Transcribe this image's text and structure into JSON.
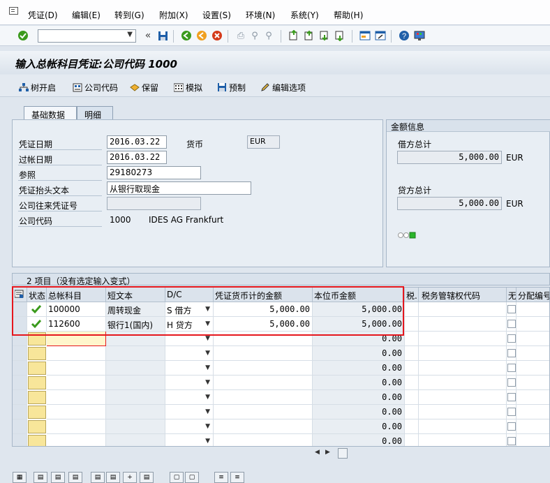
{
  "menubar": {
    "items": [
      "凭证(D)",
      "编辑(E)",
      "转到(G)",
      "附加(X)",
      "设置(S)",
      "环境(N)",
      "系统(Y)",
      "帮助(H)"
    ]
  },
  "toolbar": {
    "command_field_value": "",
    "icons": [
      "enter-icon",
      "back-double-arrow-icon",
      "save-icon",
      "back-icon",
      "exit-icon",
      "cancel-icon",
      "print-icon",
      "find-icon",
      "find-next-icon",
      "first-page-icon",
      "previous-page-icon",
      "next-page-icon",
      "last-page-icon",
      "create-session-icon",
      "shortcut-icon",
      "help-icon",
      "customize-layout-icon"
    ]
  },
  "title": "输入总帐科目凭证:公司代码 1000",
  "app_toolbar": {
    "tree_on": "树开启",
    "company_code": "公司代码",
    "hold": "保留",
    "simulate": "模拟",
    "park": "预制",
    "edit_options": "编辑选项"
  },
  "tabs": [
    "基础数据",
    "明细"
  ],
  "basic": {
    "doc_date_label": "凭证日期",
    "doc_date": "2016.03.22",
    "currency_label": "货币",
    "currency": "EUR",
    "posting_date_label": "过帐日期",
    "posting_date": "2016.03.22",
    "reference_label": "参照",
    "reference": "29180273",
    "header_text_label": "凭证抬头文本",
    "header_text": "从银行取现金",
    "intercompany_label": "公司往来凭证号",
    "intercompany": "",
    "company_code_label": "公司代码",
    "company_code": "1000",
    "company_name": "IDES AG Frankfurt"
  },
  "amount_info": {
    "title": "金额信息",
    "debit_label": "借方总计",
    "debit_value": "5,000.00",
    "debit_currency": "EUR",
    "credit_label": "贷方总计",
    "credit_value": "5,000.00",
    "credit_currency": "EUR"
  },
  "items_header": "2 项目（没有选定输入变式）",
  "table": {
    "columns": [
      "状态",
      "总帐科目",
      "短文本",
      "D/C",
      "凭证货币计的金额",
      "本位币金额",
      "税.",
      "税务管辖权代码",
      "无",
      "分配编号"
    ],
    "rows": [
      {
        "account": "100000",
        "short_text": "周转现金",
        "dc": "S 借方",
        "doc_amount": "5,000.00",
        "local_amount": "5,000.00"
      },
      {
        "account": "112600",
        "short_text": "银行1(国内)",
        "dc": "H 贷方",
        "doc_amount": "5,000.00",
        "local_amount": "5,000.00"
      }
    ],
    "empty_local_amount": "0.00",
    "empty_row_count": 8
  },
  "colors": {
    "highlight_box": "#e5161d",
    "status_ok": "#3a9a1c",
    "status_empty": "#f8e69a"
  }
}
